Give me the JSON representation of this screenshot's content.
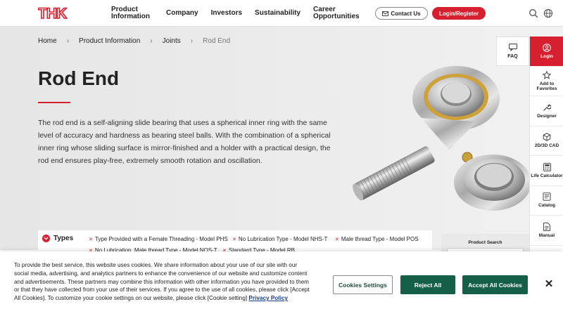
{
  "header": {
    "logo_text": "THK",
    "nav": [
      {
        "label": "Product Information"
      },
      {
        "label": "Company"
      },
      {
        "label": "Investors"
      },
      {
        "label": "Sustainability"
      },
      {
        "label": "Career Opportunities"
      }
    ],
    "contact_label": "Contact Us",
    "login_label": "Login/Register"
  },
  "breadcrumb": [
    "Home",
    "Product Information",
    "Joints",
    "Rod End"
  ],
  "page": {
    "title": "Rod End",
    "description": "The rod end is a self-aligning slide bearing that uses a spherical inner ring with the same level of accuracy and hardness as bearing steel balls. With the combination of a spherical inner ring whose sliding surface is mirror-finished and a holder with a practical design, the rod end ensures play-free, extremely smooth rotation and oscillation."
  },
  "sidebar": {
    "faq_label": "FAQ",
    "items": [
      {
        "label": "Login",
        "icon": "user-icon"
      },
      {
        "label": "Add to Favorites",
        "icon": "star-icon"
      },
      {
        "label": "Designer",
        "icon": "wrench-icon"
      },
      {
        "label": "2D/3D CAD",
        "icon": "cube-icon"
      },
      {
        "label": "Life Calculator",
        "icon": "calculator-icon"
      },
      {
        "label": "Catalog",
        "icon": "book-icon"
      },
      {
        "label": "Manual",
        "icon": "document-icon"
      }
    ]
  },
  "types": {
    "heading": "Types",
    "links": [
      "Type Provided with a Female Threading - Model PHS",
      "No Lubrication Type - Model NHS-T",
      "Male thread Type - Model POS",
      "No Lubrication, Male thread Type - Model NOS-T",
      "Standard Type - Model RB"
    ]
  },
  "product_search": {
    "label": "Product Search"
  },
  "cookie": {
    "text": "To provide the best service, this website uses cookies. We share information about your use of our site with our social media, advertising, and analytics partners to enhance the convenience of our website and customize content and advertisements. These partners may combine this information with other information you have provided to them or that they have collected from your use of their services. If you agree to the use of all cookies, please click [Accept All Cookies]. To customize your cookie settings on our website, please click [Cookie setting] ",
    "policy_link": "Privacy Policy",
    "settings_label": "Cookies Settings",
    "reject_label": "Reject All",
    "accept_label": "Accept All Cookies"
  },
  "colors": {
    "brand_red": "#d7202f",
    "cookie_green": "#155f48"
  }
}
